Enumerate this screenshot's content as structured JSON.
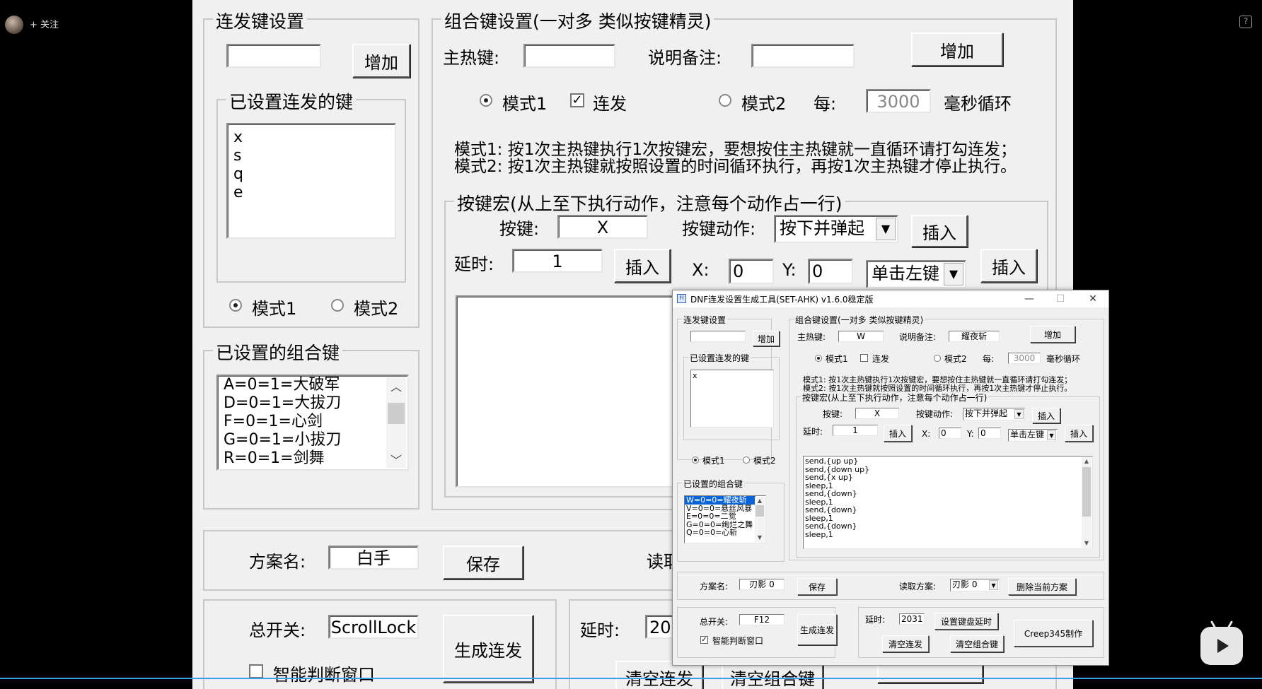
{
  "overlay": {
    "follow_label": "+ 关注",
    "help_symbol": "?"
  },
  "big": {
    "hotkey_group_title": "连发键设置",
    "hotkey_add": "增加",
    "set_keys_title": "已设置连发的键",
    "set_keys": [
      "x",
      "s",
      "q",
      "e"
    ],
    "mode1": "模式1",
    "mode2": "模式2",
    "combo_list_title": "已设置的组合键",
    "combo_items": [
      "A=0=1=大破军",
      "D=0=1=大拔刀",
      "F=0=1=心剑",
      "G=0=1=小拔刀",
      "R=0=1=剑舞"
    ],
    "combo_group_title": "组合键设置(一对多 类似按键精灵)",
    "main_hotkey_label": "主热键:",
    "remark_label": "说明备注:",
    "combo_add": "增加",
    "rapid_label": "连发",
    "every_label": "每:",
    "every_value": "3000",
    "ms_loop_label": "毫秒循环",
    "mode1_desc": "模式1: 按1次主热键执行1次按键宏，要想按住主热键就一直循环请打勾连发；",
    "mode2_desc": "模式2: 按1次主热键就按照设置的时间循环执行，再按1次主热键才停止执行。",
    "macro_group_title": "按键宏(从上至下执行动作，注意每个动作占一行)",
    "key_label": "按键:",
    "key_value": "X",
    "key_action_label": "按键动作:",
    "key_action_value": "按下并弹起",
    "insert": "插入",
    "delay_label": "延时:",
    "delay_value": "1",
    "x_label": "X:",
    "x_value": "0",
    "y_label": "Y:",
    "y_value": "0",
    "mouse_action_value": "单击左键",
    "scheme_label": "方案名:",
    "scheme_value": "白手",
    "save": "保存",
    "read_label": "读取",
    "switch_label": "总开关:",
    "switch_value": "ScrollLock",
    "generate": "生成连发",
    "smart_window": "智能判断窗口",
    "bottom_delay_label": "延时:",
    "bottom_delay_value": "20",
    "clear_rapid": "清空连发",
    "clear_combo": "清空组合键"
  },
  "win": {
    "title": "DNF连发设置生成工具(SET-AHK) v1.6.0稳定版",
    "app_icon": "H",
    "minimize": "—",
    "maximize": "☐",
    "close": "✕",
    "hotkey_group_title": "连发键设置",
    "hotkey_add": "增加",
    "set_keys_title": "已设置连发的键",
    "set_keys": [
      "x"
    ],
    "mode1": "模式1",
    "mode2": "模式2",
    "combo_list_title": "已设置的组合键",
    "combo_items": [
      "W=0=0=耀夜斩",
      "V=0=0=悬丝风暴",
      "E=0=0=二觉",
      "G=0=0=绚烂之舞",
      "Q=0=0=心斩"
    ],
    "combo_group_title": "组合键设置(一对多 类似按键精灵)",
    "main_hotkey_label": "主热键:",
    "main_hotkey_value": "W",
    "remark_label": "说明备注:",
    "remark_value": "耀夜斩",
    "combo_add": "增加",
    "rapid_label": "连发",
    "every_label": "每:",
    "every_value": "3000",
    "ms_loop_label": "毫秒循环",
    "mode1_desc": "模式1: 按1次主热键执行1次按键宏，要想按住主热键就一直循环请打勾连发；",
    "mode2_desc": "模式2: 按1次主热键就按照设置的时间循环执行，再按1次主热键才停止执行。",
    "macro_group_title": "按键宏(从上至下执行动作，注意每个动作占一行)",
    "key_label": "按键:",
    "key_value": "X",
    "key_action_label": "按键动作:",
    "key_action_value": "按下并弹起",
    "insert": "插入",
    "delay_label": "延时:",
    "delay_value": "1",
    "x_label": "X:",
    "x_value": "0",
    "y_label": "Y:",
    "y_value": "0",
    "mouse_action_value": "单击左键",
    "macro_lines": [
      "send,{up up}",
      "send,{down up}",
      "send,{x up}",
      "sleep,1",
      "send,{down}",
      "sleep,1",
      "send,{down}",
      "sleep,1",
      "send,{down}",
      "sleep,1"
    ],
    "scheme_label": "方案名:",
    "scheme_value": "刃影 0",
    "save": "保存",
    "read_label": "读取方案:",
    "read_value": "刃影 0",
    "delete_scheme": "删除当前方案",
    "switch_label": "总开关:",
    "switch_value": "F12",
    "generate": "生成连发",
    "smart_window": "智能判断窗口",
    "bottom_delay_label": "延时:",
    "bottom_delay_value": "2031",
    "set_kb_delay": "设置键盘延时",
    "clear_rapid": "清空连发",
    "clear_combo": "清空组合键",
    "credit": "Creep345制作"
  },
  "colors": {
    "selection": "#0a64d8",
    "progress": "#3aa0e0",
    "window_bg": "#f0f0f0"
  }
}
